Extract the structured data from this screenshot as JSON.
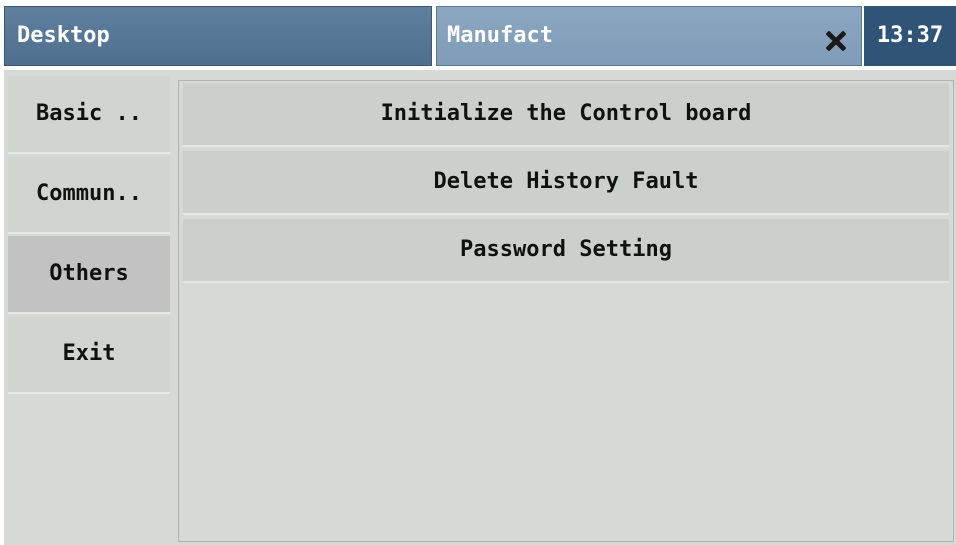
{
  "header": {
    "desktop_tab": "Desktop",
    "window_tab": "Manufact",
    "close_icon": "close-icon",
    "clock": "13:37"
  },
  "sidebar": {
    "items": [
      {
        "label": "Basic ..",
        "active": false
      },
      {
        "label": "Commun..",
        "active": false
      },
      {
        "label": "Others",
        "active": true
      },
      {
        "label": "Exit",
        "active": false
      }
    ]
  },
  "main": {
    "actions": [
      {
        "label": "Initialize the Control board"
      },
      {
        "label": "Delete History Fault"
      },
      {
        "label": "Password Setting"
      }
    ]
  },
  "colors": {
    "desktop_tab": "#5e7f9d",
    "window_tab": "#8aa6c0",
    "clock_bg": "#2f5478",
    "panel_bg": "#d6dad6",
    "active_item": "#c2c2c2"
  }
}
